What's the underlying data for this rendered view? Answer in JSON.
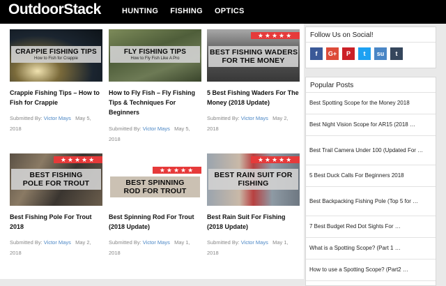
{
  "header": {
    "logo": "OutdoorStack",
    "nav": [
      "HUNTING",
      "FISHING",
      "OPTICS"
    ]
  },
  "cards": [
    {
      "banner_title": "CRAPPIE FISHING TIPS",
      "banner_sub": "How to Fish for Crappie",
      "title_line1": "Crappie Fishing Tips – How to",
      "title_line2": "Fish for Crappie",
      "submitted": "Submitted By:",
      "author": "Victor Mays",
      "date_line1": "May 5,",
      "date_line2": "2018"
    },
    {
      "banner_title": "FLY FISHING TIPS",
      "banner_sub": "How to Fly Fish Like A Pro",
      "title_line1": "How to Fly Fish – Fly Fishing",
      "title_line2": "Tips & Techniques For",
      "title_line3": "Beginners",
      "submitted": "Submitted By:",
      "author": "Victor Mays",
      "date_line1": "May 5,",
      "date_line2": "2018"
    },
    {
      "banner_title": "BEST FISHING WADERS",
      "banner_title2": "FOR THE MONEY",
      "stars": "★★★★★",
      "title_line1": "5 Best Fishing Waders For The",
      "title_line2": "Money (2018 Update)",
      "submitted": "Submitted By:",
      "author": "Victor Mays",
      "date_line1": "May 2,",
      "date_line2": "2018"
    },
    {
      "banner_title": "BEST FISHING",
      "banner_title2": "POLE FOR TROUT",
      "stars": "★★★★★",
      "title_line1": "Best Fishing Pole For Trout",
      "title_line2": "2018",
      "submitted": "Submitted By:",
      "author": "Victor Mays",
      "date_line1": "May 2,",
      "date_line2": "2018"
    },
    {
      "banner_title": "BEST SPINNING",
      "banner_title2": "ROD FOR TROUT",
      "stars": "★★★★★",
      "title_line1": "Best Spinning Rod For Trout",
      "title_line2": "(2018 Update)",
      "submitted": "Submitted By:",
      "author": "Victor Mays",
      "date_line1": "May 1,",
      "date_line2": "2018"
    },
    {
      "banner_title": "BEST RAIN SUIT FOR",
      "banner_title2": "FISHING",
      "stars": "★★★★★",
      "title_line1": "Best Rain Suit For Fishing",
      "title_line2": "(2018 Update)",
      "submitted": "Submitted By:",
      "author": "Victor Mays",
      "date_line1": "May 1,",
      "date_line2": "2018"
    }
  ],
  "social_widget": {
    "title": "Follow Us on Social!",
    "icons": [
      {
        "glyph": "f",
        "name": "facebook",
        "color": "#3b5998"
      },
      {
        "glyph": "G+",
        "name": "google-plus",
        "color": "#dd4b39"
      },
      {
        "glyph": "P",
        "name": "pinterest",
        "color": "#cb2027"
      },
      {
        "glyph": "t",
        "name": "twitter",
        "color": "#1da1f2"
      },
      {
        "glyph": "su",
        "name": "stumbleupon",
        "color": "#4a86c5"
      },
      {
        "glyph": "t",
        "name": "tumblr",
        "color": "#35465c"
      }
    ]
  },
  "popular_widget": {
    "title": "Popular Posts",
    "posts": [
      "Best Spotting Scope for the Money 2018",
      "Best Night Vision Scope for AR15 (2018 …",
      "Best Trail Camera Under 100 (Updated For …",
      "5 Best Duck Calls For Beginners 2018",
      "Best Backpacking Fishing Pole (Top 5 for …",
      "7 Best Budget Red Dot Sights For …",
      "What is a Spotting Scope? (Part 1 …",
      "How to use a Spotting Scope? (Part2 …"
    ]
  }
}
